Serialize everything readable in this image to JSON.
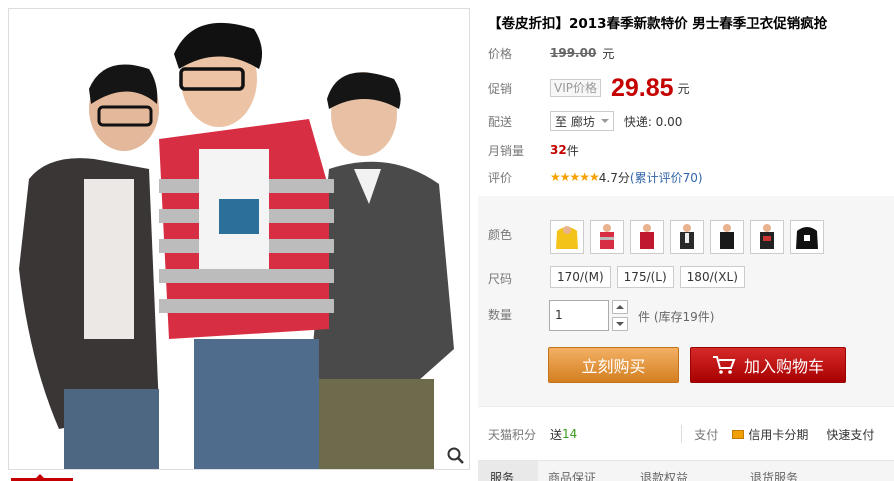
{
  "product": {
    "title": "【卷皮折扣】2013春季新款特价 男士春季卫衣促销疯抢"
  },
  "price": {
    "label": "价格",
    "original": "199.00",
    "currency": "元"
  },
  "promo": {
    "label": "促销",
    "tag": "VIP价格",
    "price": "29.85",
    "currency": "元"
  },
  "delivery": {
    "label": "配送",
    "to": "至 廊坊",
    "shipping": "快递: 0.00"
  },
  "sales": {
    "label": "月销量",
    "count": "32",
    "unit": "件"
  },
  "review": {
    "label": "评价",
    "stars": "★★★★★",
    "score": "4.7分",
    "link": "(累计评价70)"
  },
  "color": {
    "label": "颜色",
    "swatches": [
      "yellow-hoodie",
      "red-striped",
      "red-jacket",
      "dark-jacket",
      "black-tee",
      "black-hoodie",
      "print-hoodie"
    ]
  },
  "size": {
    "label": "尺码",
    "options": [
      "170/(M)",
      "175/(L)",
      "180/(XL)"
    ]
  },
  "quantity": {
    "label": "数量",
    "value": "1",
    "unit_stock": "件 (库存19件)"
  },
  "buttons": {
    "buy": "立刻购买",
    "cart": "加入购物车"
  },
  "points": {
    "label": "天猫积分",
    "give": "送",
    "value": "14"
  },
  "payment": {
    "label": "支付",
    "credit": "信用卡分期",
    "quick": "快速支付"
  },
  "tabs": [
    "服务",
    "商品保证",
    "退款权益",
    "退货服务"
  ],
  "colors": {
    "accent_red": "#c40000",
    "buy_orange": "#d47f20",
    "cart_red": "#a80000",
    "star": "#f6a100"
  }
}
